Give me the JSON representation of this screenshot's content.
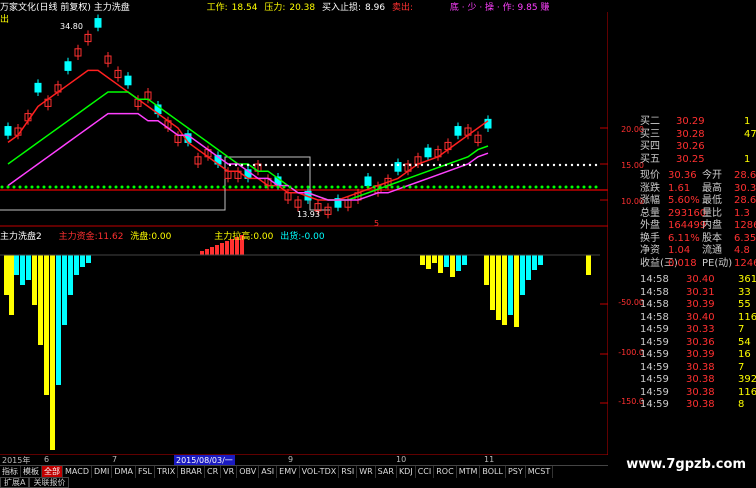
{
  "header": {
    "title": "万家文化(日线 前复权) 主力洗盘",
    "work_label": "工作:",
    "work_value": "18.54",
    "pressure_label": "压力:",
    "pressure_value": "20.38",
    "stop_label": "买入止损:",
    "stop_value": "8.96",
    "sell_label": "卖出:",
    "sub_right": "底 · 少 · 操 · 作: 9.85 赚"
  },
  "corner_label": "出",
  "peak_label": "34.80",
  "low_label": "13.93",
  "small_label_1": "5",
  "indicator": {
    "name": "主力洗盘2",
    "flow_label": "主力资金:",
    "flow_value": "11.62",
    "wash_label": "洗盘:",
    "wash_value": "0.00",
    "pull_label": "主力拉高:",
    "pull_value": "0.00",
    "out_label": "出货:",
    "out_value": "-0.00"
  },
  "price_axis": [
    "20.00",
    "15.00",
    "10.00"
  ],
  "ind_axis": [
    "-50.00",
    "-100.0",
    "-150.0"
  ],
  "dates": [
    "2015年",
    "6",
    "7",
    "2015/08/03/一",
    "9",
    "10",
    "11"
  ],
  "quote": {
    "rows": [
      {
        "l": "买二",
        "v": "30.29",
        "v2": "1"
      },
      {
        "l": "买三",
        "v": "30.28",
        "v2": "47"
      },
      {
        "l": "买四",
        "v": "30.26",
        "v2": ""
      },
      {
        "l": "买五",
        "v": "30.25",
        "v2": "1"
      }
    ],
    "stats": [
      {
        "l": "现价",
        "v": "30.36",
        "l2": "今开",
        "v2": "28.6"
      },
      {
        "l": "涨跌",
        "v": "1.61",
        "l2": "最高",
        "v2": "30.3"
      },
      {
        "l": "涨幅",
        "v": "5.60%",
        "l2": "最低",
        "v2": "28.6"
      },
      {
        "l": "总量",
        "v": "293160",
        "l2": "量比",
        "v2": "1.3"
      },
      {
        "l": "外盘",
        "v": "164499",
        "l2": "内盘",
        "v2": "12866"
      },
      {
        "l": "换手",
        "v": "6.11%",
        "l2": "股本",
        "v2": "6.35"
      },
      {
        "l": "净资",
        "v": "1.04",
        "l2": "流通",
        "v2": "4.8"
      },
      {
        "l": "收益(三)",
        "v": "0.018",
        "l2": "PE(动)",
        "v2": "1246."
      }
    ],
    "ticks": [
      {
        "t": "14:58",
        "p": "30.40",
        "n": "361"
      },
      {
        "t": "14:58",
        "p": "30.31",
        "n": "33"
      },
      {
        "t": "14:58",
        "p": "30.39",
        "n": "55"
      },
      {
        "t": "14:58",
        "p": "30.40",
        "n": "116"
      },
      {
        "t": "14:59",
        "p": "30.33",
        "n": "7"
      },
      {
        "t": "14:59",
        "p": "30.36",
        "n": "54"
      },
      {
        "t": "14:59",
        "p": "30.39",
        "n": "16"
      },
      {
        "t": "14:59",
        "p": "30.38",
        "n": "7"
      },
      {
        "t": "14:59",
        "p": "30.38",
        "n": "392"
      },
      {
        "t": "14:59",
        "p": "30.38",
        "n": "116"
      },
      {
        "t": "14:59",
        "p": "30.38",
        "n": "8"
      }
    ]
  },
  "tabs": [
    "指标",
    "模板",
    "全部",
    "MACD",
    "DMI",
    "DMA",
    "FSL",
    "TRIX",
    "BRAR",
    "CR",
    "VR",
    "OBV",
    "ASI",
    "EMV",
    "VOL-TDX",
    "RSI",
    "WR",
    "SAR",
    "KDJ",
    "CCI",
    "ROC",
    "MTM",
    "BOLL",
    "PSY",
    "MCST"
  ],
  "bottom_tabs": [
    "扩展A",
    "关联报价"
  ],
  "watermark": "www.7gpzb.com",
  "colors": {
    "up": "#ff3030",
    "down": "#00ffff",
    "ma1": "#ff2020",
    "ma2": "#ffffff",
    "ma3": "#00ff00",
    "ma4": "#ff40ff"
  }
}
